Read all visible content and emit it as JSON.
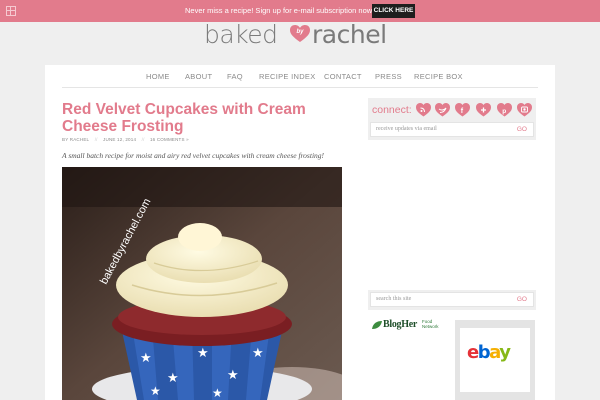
{
  "topbar": {
    "message": "Never miss a recipe! Sign up for e-mail subscription now!",
    "cta_label": "CLICK HERE",
    "accent": "#e27b8c"
  },
  "logo": {
    "word1": "baked",
    "by": "by",
    "word2": "rachel"
  },
  "nav": {
    "items": [
      "HOME",
      "ABOUT",
      "FAQ",
      "RECIPE INDEX",
      "CONTACT",
      "PRESS",
      "RECIPE BOX"
    ]
  },
  "post": {
    "title": "Red Velvet Cupcakes with Cream Cheese Frosting",
    "author": "BY RACHEL",
    "date": "JUNE 12, 2014",
    "comments": "16 COMMENTS »",
    "summary": "A small batch recipe for moist and airy red velvet cupcakes with cream cheese frosting!",
    "image_watermark": "bakedbyrachel.com"
  },
  "sidebar": {
    "connect_label": "connect:",
    "social_icons": [
      "rss-icon",
      "twitter-icon",
      "facebook-icon",
      "google-plus-icon",
      "pinterest-icon",
      "instagram-icon"
    ],
    "subscribe": {
      "placeholder": "receive updates via email",
      "go": "GO"
    },
    "search": {
      "placeholder": "search this site",
      "go": "GO"
    },
    "blogher": {
      "name": "BlogHer",
      "sub": "Food Network"
    },
    "ad": {
      "brand": "ebay"
    }
  }
}
